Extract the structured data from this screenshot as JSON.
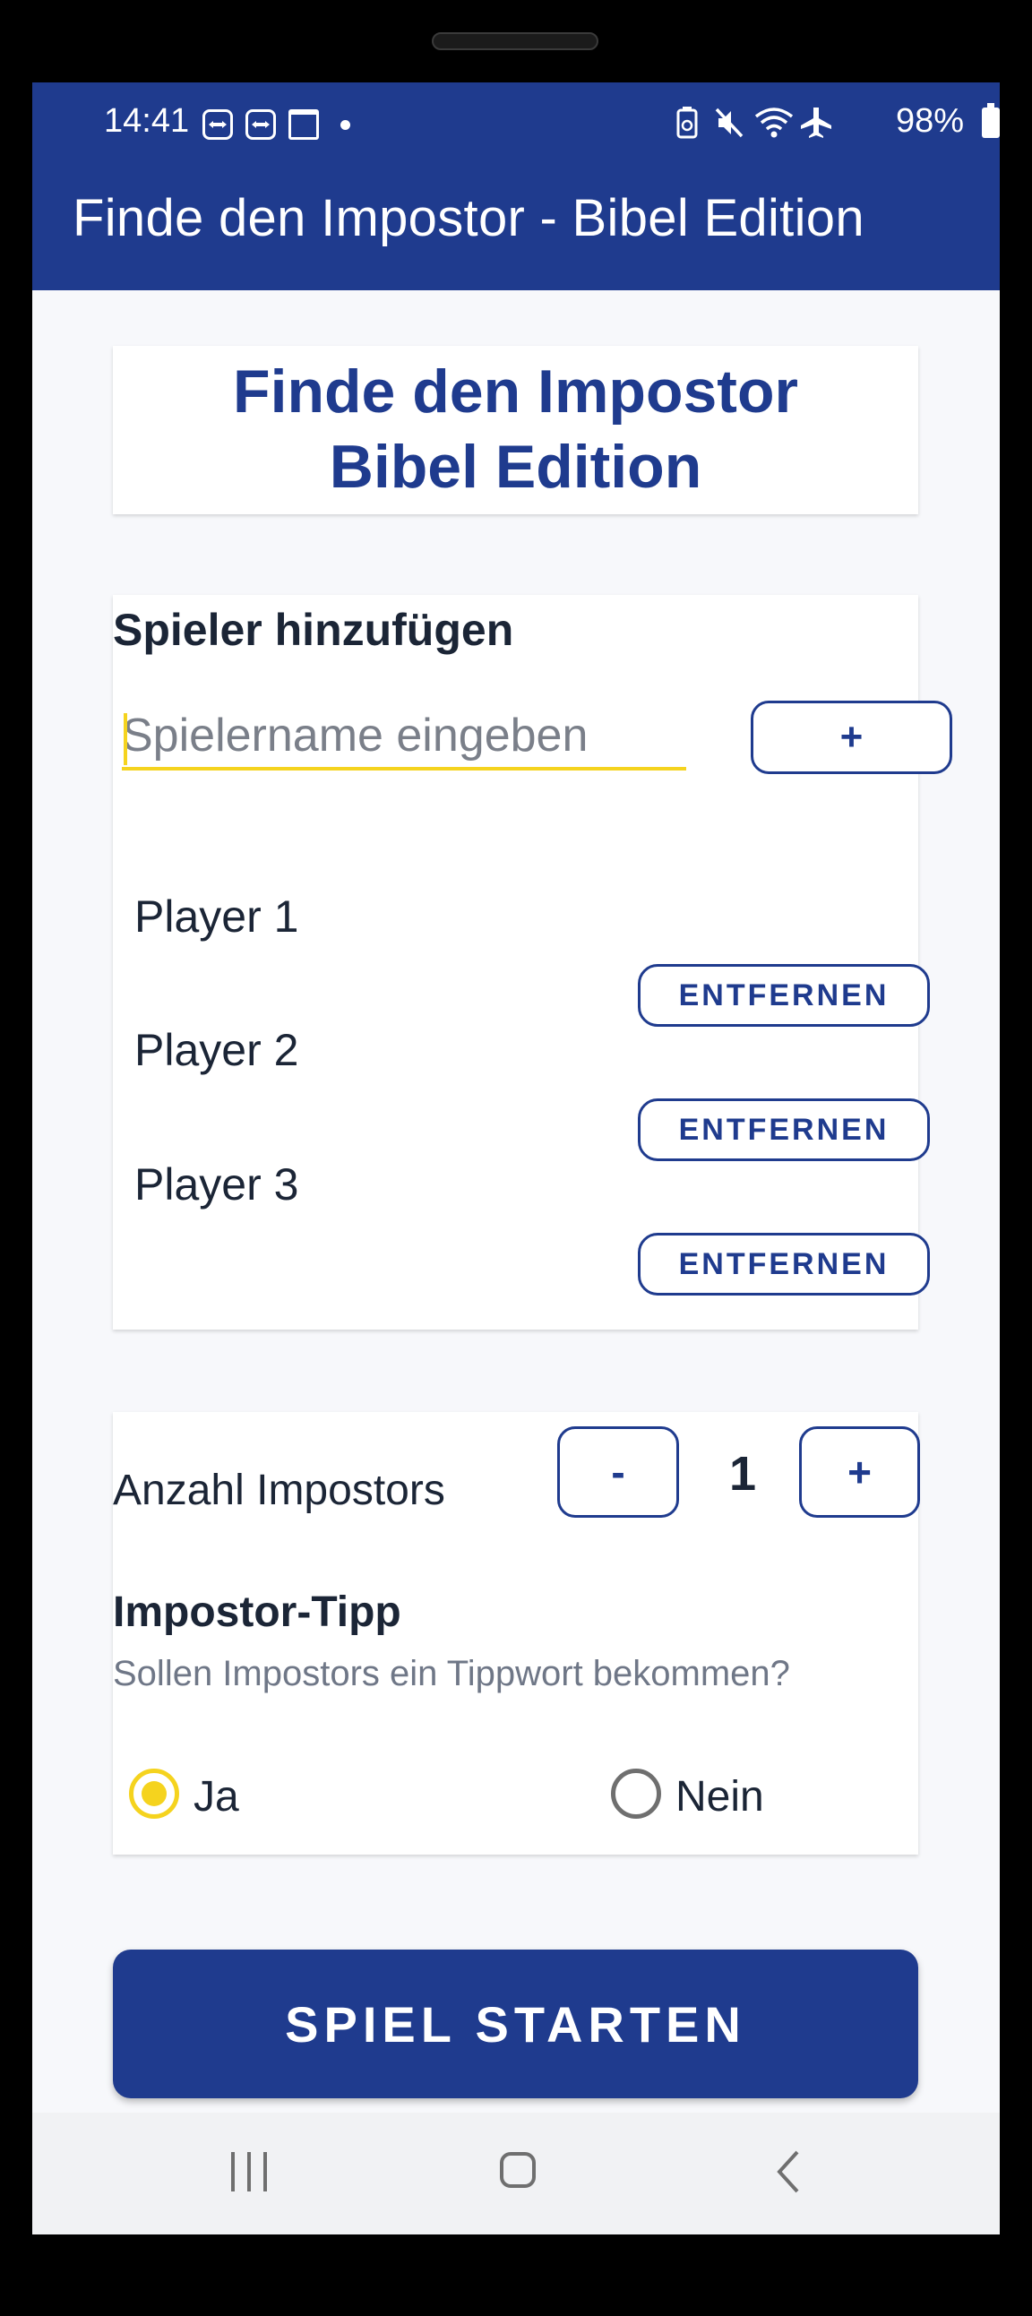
{
  "status_bar": {
    "time": "14:41",
    "battery": "98%",
    "left_icons": [
      "teamviewer-icon",
      "teamviewer-icon",
      "calendar-icon",
      "notification-dot"
    ],
    "right_icons": [
      "battery-saver-icon",
      "mute-icon",
      "wifi-icon",
      "airplane-icon"
    ]
  },
  "app_bar": {
    "title": "Finde den Impostor - Bibel Edition"
  },
  "hero": {
    "line1": "Finde den Impostor",
    "line2": "Bibel Edition"
  },
  "players_section": {
    "heading": "Spieler hinzufügen",
    "input_placeholder": "Spielername eingeben",
    "input_value": "",
    "add_label": "+",
    "remove_label": "ENTFERNEN",
    "players": [
      "Player 1",
      "Player 2",
      "Player 3"
    ]
  },
  "settings": {
    "impostor_label": "Anzahl Impostors",
    "minus_label": "-",
    "count": "1",
    "plus_label": "+",
    "tipp_title": "Impostor-Tipp",
    "tipp_subtitle": "Sollen Impostors ein Tippwort bekommen?",
    "options": [
      {
        "label": "Ja",
        "selected": true
      },
      {
        "label": "Nein",
        "selected": false
      }
    ]
  },
  "start_button": "SPIEL STARTEN",
  "colors": {
    "primary": "#1f3b8e",
    "accent": "#f5d31e",
    "background": "#f7f8fb",
    "text": "#1b2536",
    "muted": "#6f7787"
  },
  "nav_bar": [
    "recent-apps-icon",
    "home-icon",
    "back-icon"
  ]
}
